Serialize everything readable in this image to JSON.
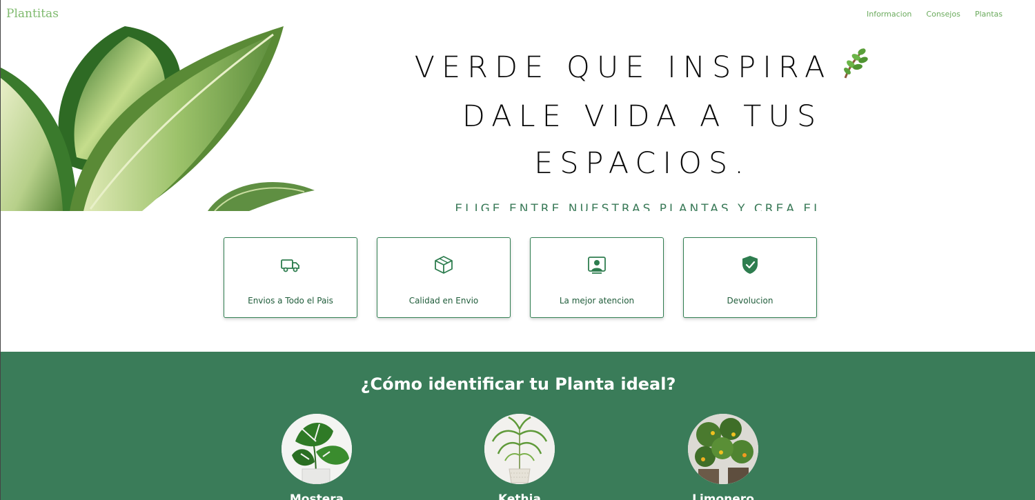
{
  "nav": {
    "brand": "Plantitas",
    "links": [
      "Informacion",
      "Consejos",
      "Plantas"
    ]
  },
  "hero": {
    "line1": "VERDE QUE INSPIRA",
    "line2": "DALE VIDA A TUS",
    "line3": "ESPACIOS.",
    "leaf_emoji": "🌿",
    "subline": "ELIGE ENTRE NUESTRAS PLANTAS Y CREA EL"
  },
  "features": [
    {
      "label": "Envios a Todo el Pais",
      "icon": "truck-icon"
    },
    {
      "label": "Calidad en Envio",
      "icon": "box-icon"
    },
    {
      "label": "La mejor atencion",
      "icon": "support-agent-icon"
    },
    {
      "label": "Devolucion",
      "icon": "shield-check-icon"
    }
  ],
  "section": {
    "title": "¿Cómo identificar tu Planta ideal?",
    "plants": [
      {
        "name": "Mostera"
      },
      {
        "name": "Kethia"
      },
      {
        "name": "Limonero"
      }
    ]
  },
  "colors": {
    "accent_green": "#3a7c59",
    "nav_green": "#6aaa5c",
    "card_border": "#2e7d4f"
  }
}
